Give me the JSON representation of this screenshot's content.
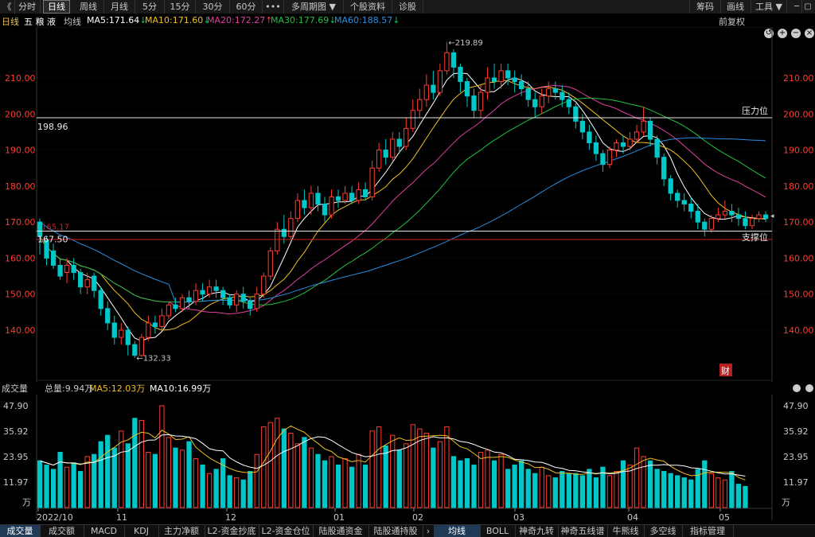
{
  "toolbar": {
    "back_label": "《",
    "items": [
      "分时",
      "日线",
      "周线",
      "月线",
      "5分",
      "15分",
      "30分",
      "60分",
      "•••",
      "多周期图 ▼",
      "个股资料",
      "诊股"
    ],
    "right": [
      "筹码",
      "画线",
      "工具 ▼"
    ]
  },
  "ma_row": {
    "period": "日线",
    "stock": "五 粮 液",
    "avg": "均线",
    "ma5": "MA5:171.64",
    "ma10": "MA10:171.60",
    "ma20": "MA20:172.27",
    "ma30": "MA30:177.69",
    "ma60": "MA60:188.57",
    "adjust": "前复权"
  },
  "colors": {
    "up": "#ff3b30",
    "down": "#00c8c8",
    "ma5": "#ffffff",
    "ma10": "#f0c020",
    "ma20": "#e040a0",
    "ma30": "#20c040",
    "ma60": "#2a8de0",
    "bg": "#000000"
  },
  "price_chart": {
    "yaxis_labels": [
      "210.00",
      "200.00",
      "190.00",
      "180.00",
      "170.00",
      "160.00",
      "150.00",
      "140.00"
    ],
    "resistance_label": "压力位",
    "resistance_value": "198.96",
    "support_label": "支撑位",
    "support_value": "167.50",
    "red_line_value": "165.17",
    "high_label": "219.89",
    "low_label": "132.33",
    "cai_label": "财"
  },
  "volume_panel": {
    "title": "成交量",
    "total": "总量:9.94万",
    "ma5": "MA5:12.03万",
    "ma10": "MA10:16.99万",
    "yaxis_labels": [
      "47.90",
      "35.92",
      "23.95",
      "11.97"
    ],
    "unit": "万",
    "x_labels": [
      "2022/10",
      "11",
      "12",
      "01",
      "02",
      "03",
      "04",
      "05"
    ]
  },
  "bottom_tabs": [
    "成交量",
    "成交额",
    "MACD",
    "KDJ",
    "主力净额",
    "L2-资金抄底",
    "L2-资金仓位",
    "陆股通资金",
    "陆股通持股",
    "›",
    "均线",
    "BOLL",
    "神奇九转",
    "神奇五线谱",
    "牛熊线",
    "多空线",
    "指标管理"
  ],
  "chart_data": {
    "type": "candlestick",
    "x_axis_labels": [
      "2022/10",
      "11",
      "12",
      "01",
      "02",
      "03",
      "04",
      "05"
    ],
    "price_axis": [
      130,
      222
    ],
    "annotations": {
      "high": 219.89,
      "low": 132.33,
      "resistance": 198.96,
      "support": 167.5,
      "ref": 165.17
    },
    "ma_last": {
      "MA5": 171.64,
      "MA10": 171.6,
      "MA20": 172.27,
      "MA30": 177.69,
      "MA60": 188.57
    },
    "candles": [
      [
        170,
        166,
        171,
        161
      ],
      [
        165,
        160,
        166,
        158
      ],
      [
        162,
        158,
        164,
        157
      ],
      [
        158,
        155,
        160,
        154
      ],
      [
        156,
        158,
        160,
        153
      ],
      [
        158,
        156,
        160,
        154
      ],
      [
        156,
        152,
        157,
        150
      ],
      [
        152,
        154,
        156,
        150
      ],
      [
        155,
        151,
        156,
        149
      ],
      [
        151,
        146,
        152,
        144
      ],
      [
        146,
        142,
        148,
        140
      ],
      [
        142,
        138,
        144,
        136
      ],
      [
        138,
        140,
        142,
        136
      ],
      [
        140,
        136,
        141,
        133
      ],
      [
        136,
        133,
        137,
        132.33
      ],
      [
        133,
        138,
        139,
        132.5
      ],
      [
        138,
        142,
        144,
        137
      ],
      [
        142,
        141,
        144,
        139
      ],
      [
        141,
        144,
        146,
        140
      ],
      [
        144,
        147,
        148,
        143
      ],
      [
        147,
        146,
        149,
        145
      ],
      [
        146,
        149,
        150,
        145
      ],
      [
        149,
        148,
        151,
        146
      ],
      [
        148,
        151,
        153,
        147
      ],
      [
        151,
        150,
        153,
        148
      ],
      [
        150,
        152,
        154,
        149
      ],
      [
        152,
        151,
        154,
        149
      ],
      [
        151,
        149,
        152,
        147
      ],
      [
        149,
        147,
        150,
        146
      ],
      [
        147,
        150,
        151,
        145
      ],
      [
        150,
        148,
        152,
        146
      ],
      [
        148,
        146,
        149,
        144
      ],
      [
        146,
        150,
        152,
        145
      ],
      [
        150,
        155,
        156,
        149
      ],
      [
        155,
        162,
        163,
        154
      ],
      [
        162,
        168,
        170,
        161
      ],
      [
        168,
        166,
        172,
        164
      ],
      [
        166,
        171,
        173,
        165
      ],
      [
        171,
        176,
        178,
        170
      ],
      [
        176,
        174,
        179,
        172
      ],
      [
        174,
        178,
        180,
        172
      ],
      [
        178,
        175,
        180,
        173
      ],
      [
        175,
        172,
        177,
        170
      ],
      [
        172,
        177,
        179,
        171
      ],
      [
        177,
        176,
        179,
        174
      ],
      [
        176,
        178,
        180,
        175
      ],
      [
        178,
        176,
        180,
        175
      ],
      [
        176,
        179,
        181,
        175
      ],
      [
        179,
        177,
        181,
        176
      ],
      [
        177,
        185,
        187,
        176
      ],
      [
        185,
        190,
        192,
        184
      ],
      [
        190,
        188,
        193,
        186
      ],
      [
        188,
        193,
        195,
        187
      ],
      [
        193,
        191,
        195,
        189
      ],
      [
        191,
        196,
        199,
        190
      ],
      [
        196,
        201,
        204,
        195
      ],
      [
        201,
        204,
        207,
        199
      ],
      [
        204,
        208,
        211,
        202
      ],
      [
        208,
        206,
        212,
        204
      ],
      [
        206,
        212,
        214,
        205
      ],
      [
        212,
        217,
        219.89,
        211
      ],
      [
        217,
        213,
        218,
        210
      ],
      [
        213,
        209,
        214,
        206
      ],
      [
        209,
        205,
        210,
        202
      ],
      [
        205,
        201,
        207,
        199
      ],
      [
        201,
        206,
        208,
        199
      ],
      [
        206,
        210,
        213,
        204
      ],
      [
        210,
        209,
        214,
        207
      ],
      [
        209,
        212,
        214,
        207
      ],
      [
        212,
        210,
        214,
        208
      ],
      [
        210,
        209,
        212,
        206
      ],
      [
        209,
        207,
        211,
        205
      ],
      [
        207,
        204,
        209,
        202
      ],
      [
        204,
        202,
        206,
        199
      ],
      [
        202,
        205,
        207,
        200
      ],
      [
        205,
        207,
        209,
        203
      ],
      [
        207,
        206,
        209,
        204
      ],
      [
        206,
        204,
        208,
        202
      ],
      [
        204,
        202,
        206,
        200
      ],
      [
        202,
        198,
        203,
        196
      ],
      [
        198,
        195,
        200,
        193
      ],
      [
        195,
        192,
        197,
        190
      ],
      [
        192,
        189,
        194,
        187
      ],
      [
        189,
        186,
        190,
        184
      ],
      [
        186,
        190,
        191,
        185
      ],
      [
        190,
        192,
        193,
        188
      ],
      [
        192,
        191,
        194,
        189
      ],
      [
        191,
        193,
        195,
        190
      ],
      [
        193,
        195,
        197,
        192
      ],
      [
        195,
        198,
        202,
        194
      ],
      [
        198,
        193,
        199,
        191
      ],
      [
        193,
        188,
        194,
        186
      ],
      [
        188,
        182,
        189,
        180
      ],
      [
        182,
        178,
        183,
        176
      ],
      [
        178,
        176,
        179,
        174
      ],
      [
        176,
        175,
        178,
        173
      ],
      [
        175,
        173,
        177,
        171
      ],
      [
        173,
        170,
        175,
        168
      ],
      [
        170,
        168,
        171,
        166
      ],
      [
        168,
        171,
        172,
        167
      ],
      [
        171,
        172,
        174,
        170
      ],
      [
        172,
        173,
        176,
        171
      ],
      [
        173,
        172,
        175,
        170
      ],
      [
        172,
        171,
        174,
        169
      ],
      [
        171,
        169,
        173,
        168
      ],
      [
        169,
        171,
        172,
        168
      ],
      [
        171,
        172,
        173,
        170
      ],
      [
        172,
        171,
        173,
        170
      ]
    ],
    "volumes": [
      22,
      20,
      18,
      26,
      19,
      21,
      17,
      24,
      25,
      31,
      34,
      28,
      36,
      30,
      42,
      41,
      26,
      25,
      47.9,
      33,
      28,
      27,
      31,
      23,
      20,
      16,
      18,
      23,
      15,
      14,
      13,
      17,
      25,
      38,
      40,
      42,
      37,
      35,
      30,
      33,
      28,
      25,
      22,
      24,
      20,
      23,
      19,
      25,
      20,
      36,
      38,
      29,
      34,
      27,
      30,
      39,
      37,
      35,
      28,
      31,
      38,
      24,
      22,
      23,
      20,
      26,
      27,
      22,
      25,
      18,
      20,
      22,
      18,
      16,
      19,
      15,
      14,
      17,
      16,
      16,
      15,
      18,
      14,
      19,
      15,
      17,
      22,
      20,
      28,
      24,
      22,
      18,
      17,
      16,
      15,
      14,
      13,
      18,
      22,
      16,
      14,
      13,
      17,
      11,
      9.94
    ]
  }
}
